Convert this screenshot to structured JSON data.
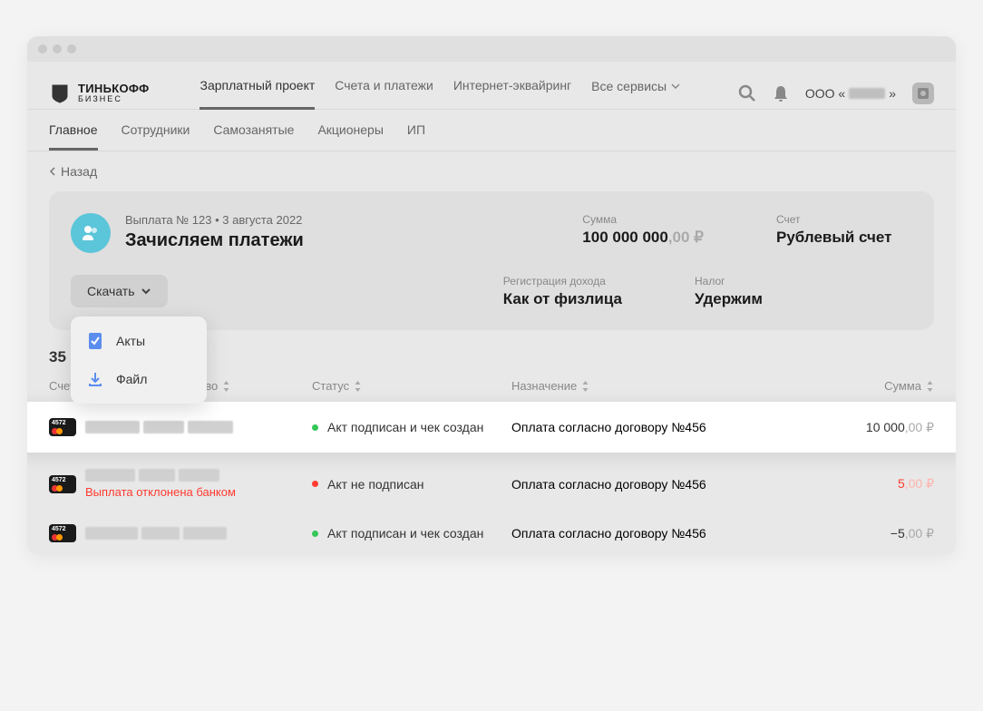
{
  "logo": {
    "main": "ТИНЬКОФФ",
    "sub": "БИЗНЕС"
  },
  "main_nav": {
    "items": [
      "Зарплатный проект",
      "Счета и платежи",
      "Интернет-эквайринг",
      "Все сервисы"
    ],
    "active_index": 0
  },
  "org_prefix": "ООО «",
  "org_suffix": "»",
  "sub_nav": {
    "items": [
      "Главное",
      "Сотрудники",
      "Самозанятые",
      "Акционеры",
      "ИП"
    ],
    "active_index": 0
  },
  "back": "Назад",
  "summary": {
    "meta": "Выплата № 123 • 3 августа 2022",
    "title": "Зачисляем платежи",
    "amount_label": "Сумма",
    "amount_int": "100 000 000",
    "amount_dec": ",00 ₽",
    "account_label": "Счет",
    "account_value": "Рублевый счет",
    "reg_label": "Регистрация дохода",
    "reg_value": "Как от физлица",
    "tax_label": "Налог",
    "tax_value": "Удержим",
    "download_btn": "Скачать",
    "download_menu": [
      "Акты",
      "Файл"
    ]
  },
  "count_label": "35 с",
  "table": {
    "headers": {
      "account": "Счет",
      "name": "Фамилия, имя, отчество",
      "status": "Статус",
      "purpose": "Назначение",
      "amount": "Сумма"
    },
    "rows": [
      {
        "card": "4572",
        "status_color": "green",
        "status": "Акт подписан и чек создан",
        "purpose": "Оплата согласно договору №456",
        "amount_int": "10 000",
        "amount_dec": ",00 ₽",
        "amount_class": "",
        "error": "",
        "highlight": true
      },
      {
        "card": "4572",
        "status_color": "red",
        "status": "Акт не подписан",
        "purpose": "Оплата согласно договору №456",
        "amount_int": "5",
        "amount_dec": ",00 ₽",
        "amount_class": "red",
        "error": "Выплата отклонена банком",
        "highlight": false
      },
      {
        "card": "4572",
        "status_color": "green",
        "status": "Акт подписан и чек создан",
        "purpose": "Оплата согласно договору №456",
        "amount_int": "−5",
        "amount_dec": ",00 ₽",
        "amount_class": "",
        "error": "",
        "highlight": false
      }
    ]
  }
}
